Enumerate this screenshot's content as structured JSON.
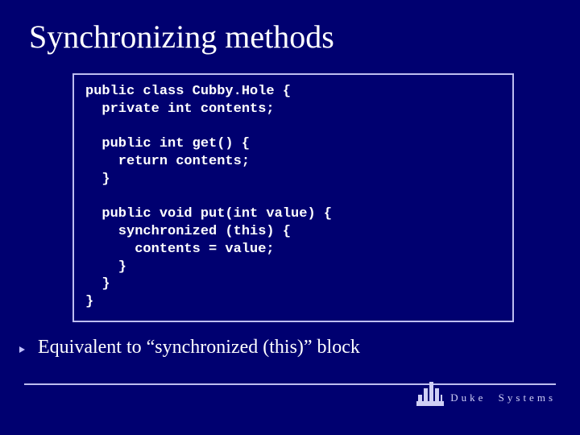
{
  "title": "Synchronizing methods",
  "code": "public class Cubby.Hole {\n  private int contents;\n\n  public int get() {\n    return contents;\n  }\n\n  public void put(int value) {\n    synchronized (this) {\n      contents = value;\n    }\n  }\n}",
  "bullets": [
    "Equivalent to “synchronized (this)” block"
  ],
  "brand": {
    "word1": "Duke",
    "word2": "Systems"
  }
}
